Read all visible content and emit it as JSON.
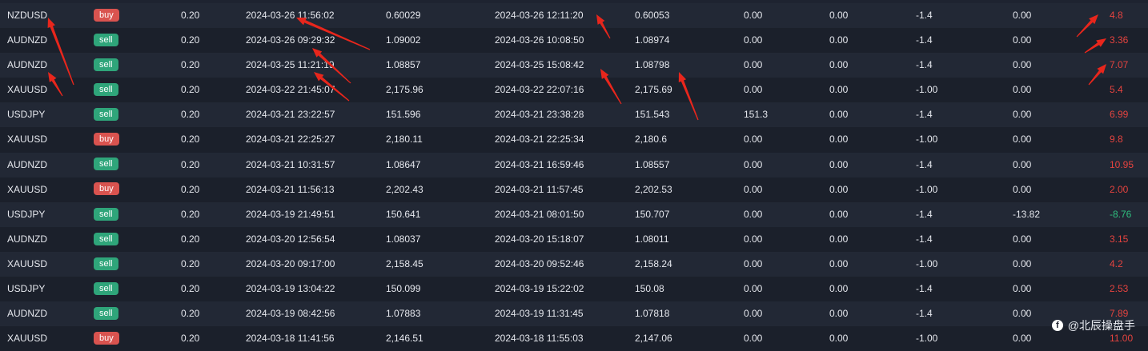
{
  "columns": [
    "symbol",
    "side",
    "lots",
    "open_time",
    "open_price",
    "close_time",
    "close_price",
    "sl",
    "tp",
    "swap",
    "commission",
    "profit"
  ],
  "rows": [
    {
      "symbol": "NZDUSD",
      "side": "buy",
      "lots": "0.20",
      "open_time": "2024-03-26 11:56:02",
      "open_price": "0.60029",
      "close_time": "2024-03-26 12:11:20",
      "close_price": "0.60053",
      "sl": "0.00",
      "tp": "0.00",
      "swap": "-1.4",
      "commission": "0.00",
      "profit": "4.8",
      "profit_sign": "pos"
    },
    {
      "symbol": "AUDNZD",
      "side": "sell",
      "lots": "0.20",
      "open_time": "2024-03-26 09:29:32",
      "open_price": "1.09002",
      "close_time": "2024-03-26 10:08:50",
      "close_price": "1.08974",
      "sl": "0.00",
      "tp": "0.00",
      "swap": "-1.4",
      "commission": "0.00",
      "profit": "3.36",
      "profit_sign": "pos"
    },
    {
      "symbol": "AUDNZD",
      "side": "sell",
      "lots": "0.20",
      "open_time": "2024-03-25 11:21:19",
      "open_price": "1.08857",
      "close_time": "2024-03-25 15:08:42",
      "close_price": "1.08798",
      "sl": "0.00",
      "tp": "0.00",
      "swap": "-1.4",
      "commission": "0.00",
      "profit": "7.07",
      "profit_sign": "pos"
    },
    {
      "symbol": "XAUUSD",
      "side": "sell",
      "lots": "0.20",
      "open_time": "2024-03-22 21:45:07",
      "open_price": "2,175.96",
      "close_time": "2024-03-22 22:07:16",
      "close_price": "2,175.69",
      "sl": "0.00",
      "tp": "0.00",
      "swap": "-1.00",
      "commission": "0.00",
      "profit": "5.4",
      "profit_sign": "pos"
    },
    {
      "symbol": "USDJPY",
      "side": "sell",
      "lots": "0.20",
      "open_time": "2024-03-21 23:22:57",
      "open_price": "151.596",
      "close_time": "2024-03-21 23:38:28",
      "close_price": "151.543",
      "sl": "151.3",
      "tp": "0.00",
      "swap": "-1.4",
      "commission": "0.00",
      "profit": "6.99",
      "profit_sign": "pos"
    },
    {
      "symbol": "XAUUSD",
      "side": "buy",
      "lots": "0.20",
      "open_time": "2024-03-21 22:25:27",
      "open_price": "2,180.11",
      "close_time": "2024-03-21 22:25:34",
      "close_price": "2,180.6",
      "sl": "0.00",
      "tp": "0.00",
      "swap": "-1.00",
      "commission": "0.00",
      "profit": "9.8",
      "profit_sign": "pos"
    },
    {
      "symbol": "AUDNZD",
      "side": "sell",
      "lots": "0.20",
      "open_time": "2024-03-21 10:31:57",
      "open_price": "1.08647",
      "close_time": "2024-03-21 16:59:46",
      "close_price": "1.08557",
      "sl": "0.00",
      "tp": "0.00",
      "swap": "-1.4",
      "commission": "0.00",
      "profit": "10.95",
      "profit_sign": "pos"
    },
    {
      "symbol": "XAUUSD",
      "side": "buy",
      "lots": "0.20",
      "open_time": "2024-03-21 11:56:13",
      "open_price": "2,202.43",
      "close_time": "2024-03-21 11:57:45",
      "close_price": "2,202.53",
      "sl": "0.00",
      "tp": "0.00",
      "swap": "-1.00",
      "commission": "0.00",
      "profit": "2.00",
      "profit_sign": "pos"
    },
    {
      "symbol": "USDJPY",
      "side": "sell",
      "lots": "0.20",
      "open_time": "2024-03-19 21:49:51",
      "open_price": "150.641",
      "close_time": "2024-03-21 08:01:50",
      "close_price": "150.707",
      "sl": "0.00",
      "tp": "0.00",
      "swap": "-1.4",
      "commission": "-13.82",
      "profit": "-8.76",
      "profit_sign": "neg"
    },
    {
      "symbol": "AUDNZD",
      "side": "sell",
      "lots": "0.20",
      "open_time": "2024-03-20 12:56:54",
      "open_price": "1.08037",
      "close_time": "2024-03-20 15:18:07",
      "close_price": "1.08011",
      "sl": "0.00",
      "tp": "0.00",
      "swap": "-1.4",
      "commission": "0.00",
      "profit": "3.15",
      "profit_sign": "pos"
    },
    {
      "symbol": "XAUUSD",
      "side": "sell",
      "lots": "0.20",
      "open_time": "2024-03-20 09:17:00",
      "open_price": "2,158.45",
      "close_time": "2024-03-20 09:52:46",
      "close_price": "2,158.24",
      "sl": "0.00",
      "tp": "0.00",
      "swap": "-1.00",
      "commission": "0.00",
      "profit": "4.2",
      "profit_sign": "pos"
    },
    {
      "symbol": "USDJPY",
      "side": "sell",
      "lots": "0.20",
      "open_time": "2024-03-19 13:04:22",
      "open_price": "150.099",
      "close_time": "2024-03-19 15:22:02",
      "close_price": "150.08",
      "sl": "0.00",
      "tp": "0.00",
      "swap": "-1.4",
      "commission": "0.00",
      "profit": "2.53",
      "profit_sign": "pos"
    },
    {
      "symbol": "AUDNZD",
      "side": "sell",
      "lots": "0.20",
      "open_time": "2024-03-19 08:42:56",
      "open_price": "1.07883",
      "close_time": "2024-03-19 11:31:45",
      "close_price": "1.07818",
      "sl": "0.00",
      "tp": "0.00",
      "swap": "-1.4",
      "commission": "0.00",
      "profit": "7.89",
      "profit_sign": "pos"
    },
    {
      "symbol": "XAUUSD",
      "side": "buy",
      "lots": "0.20",
      "open_time": "2024-03-18 11:41:56",
      "open_price": "2,146.51",
      "close_time": "2024-03-18 11:55:03",
      "close_price": "2,147.06",
      "sl": "0.00",
      "tp": "0.00",
      "swap": "-1.00",
      "commission": "0.00",
      "profit": "11.00",
      "profit_sign": "pos"
    }
  ],
  "colors": {
    "buy": "#d9534f",
    "sell": "#2fa57a",
    "profit_pos": "#e5433f",
    "profit_neg": "#2fbf7f",
    "arrow": "#e8261c"
  },
  "watermark": {
    "text": "@北辰操盘手",
    "icon": "platform-logo-icon"
  }
}
